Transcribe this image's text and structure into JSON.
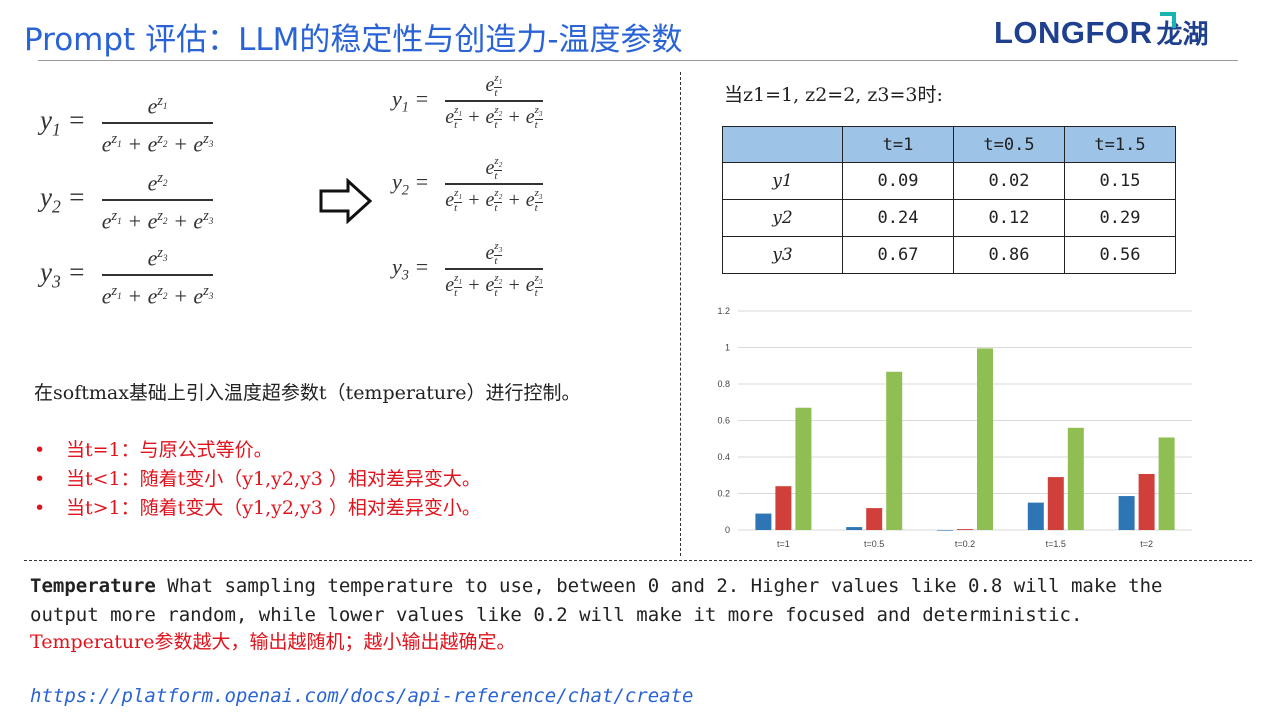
{
  "title": "Prompt 评估：LLM的稳定性与创造力-温度参数",
  "logo": {
    "word": "LONGFOR",
    "cn": "龙湖"
  },
  "colors": {
    "title": "#2a63d6",
    "red": "#e0141d",
    "table_header": "#9dc3e6",
    "bar_blue": "#2e75b6",
    "bar_red": "#d13f3a",
    "bar_green": "#8fbf53"
  },
  "formulas": {
    "left": [
      {
        "lhs": "y1",
        "num": "e^z1",
        "den": "e^z1 + e^z2 + e^z3"
      },
      {
        "lhs": "y2",
        "num": "e^z2",
        "den": "e^z1 + e^z2 + e^z3"
      },
      {
        "lhs": "y3",
        "num": "e^z3",
        "den": "e^z1 + e^z2 + e^z3"
      }
    ],
    "right": [
      {
        "lhs": "y1",
        "num": "e^(z1/t)",
        "den": "e^(z1/t) + e^(z2/t) + e^(z3/t)"
      },
      {
        "lhs": "y2",
        "num": "e^(z2/t)",
        "den": "e^(z1/t) + e^(z2/t) + e^(z3/t)"
      },
      {
        "lhs": "y3",
        "num": "e^(z3/t)",
        "den": "e^(z1/t) + e^(z2/t) + e^(z3/t)"
      }
    ]
  },
  "intro": "在softmax基础上引入温度超参数t（temperature）进行控制。",
  "bullets": [
    {
      "prefix": "当t=1：",
      "text": "与原公式等价。"
    },
    {
      "prefix": "当t<1：",
      "text": "随着t变小（y1,y2,y3 ）相对差异变大。"
    },
    {
      "prefix": "当t>1：",
      "text": "随着t变大（y1,y2,y3 ）相对差异变小。"
    }
  ],
  "condition": "当z1=1, z2=2, z3=3时:",
  "table": {
    "headers": [
      "",
      "t=1",
      "t=0.5",
      "t=1.5"
    ],
    "rows": [
      {
        "label": "y1",
        "values": [
          "0.09",
          "0.02",
          "0.15"
        ]
      },
      {
        "label": "y2",
        "values": [
          "0.24",
          "0.12",
          "0.29"
        ]
      },
      {
        "label": "y3",
        "values": [
          "0.67",
          "0.86",
          "0.56"
        ]
      }
    ]
  },
  "chart_data": {
    "type": "bar",
    "categories": [
      "t=1",
      "t=0.5",
      "t=0.2",
      "t=1.5",
      "t=2"
    ],
    "series": [
      {
        "values": [
          0.09,
          0.016,
          0.0,
          0.15,
          0.186
        ]
      },
      {
        "values": [
          0.24,
          0.12,
          0.005,
          0.29,
          0.307
        ]
      },
      {
        "values": [
          0.67,
          0.867,
          0.995,
          0.56,
          0.507
        ]
      }
    ],
    "ylim": [
      0,
      1.2
    ],
    "yticks": [
      "0",
      "0.2",
      "0.4",
      "0.6",
      "0.8",
      "1",
      "1.2"
    ],
    "grid": true
  },
  "temperature": {
    "bold": "Temperature",
    "text": " What sampling temperature to use, between 0 and 2. Higher values like 0.8 will make the output more random, while lower values like 0.2 will make it more focused and deterministic.",
    "cn": "Temperature参数越大，输出越随机；越小输出越确定。"
  },
  "link": "https://platform.openai.com/docs/api-reference/chat/create"
}
